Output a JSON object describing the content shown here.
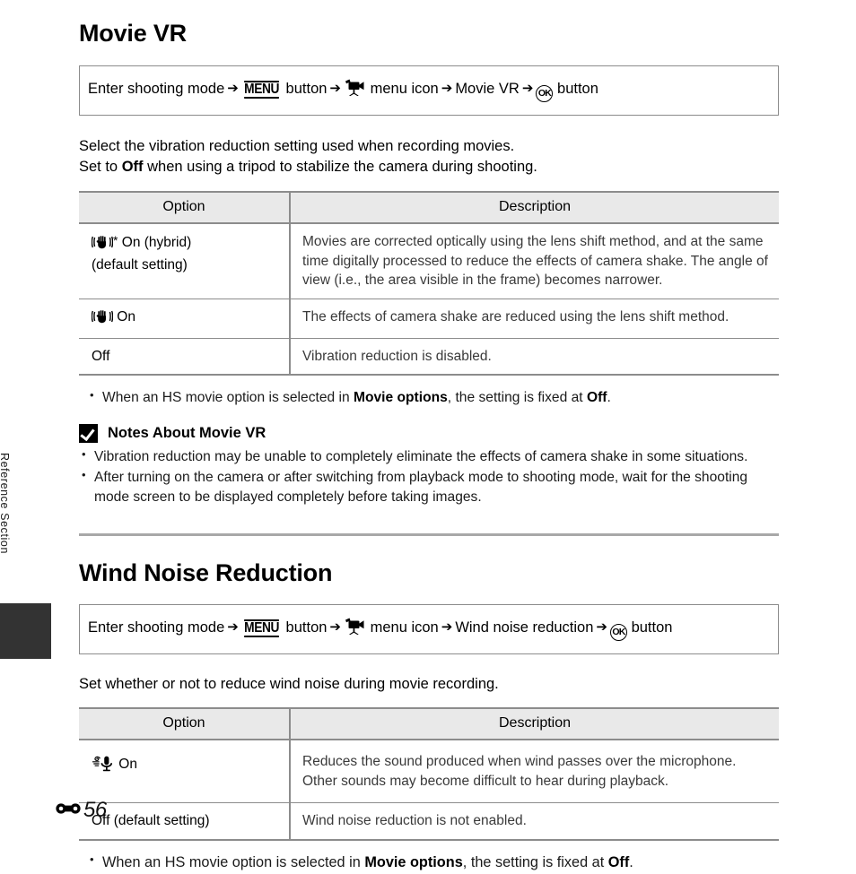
{
  "sidebar": {
    "vertical_label": "Reference Section"
  },
  "footer": {
    "marker_icon": "reference-section-bone-icon",
    "page_number": "56"
  },
  "movie_vr": {
    "title": "Movie VR",
    "nav_path": {
      "step1": "Enter shooting mode",
      "menu_icon_name": "menu-button-glyph",
      "menu_label": "MENU",
      "step2": "button",
      "movie_icon_name": "movie-camera-icon",
      "step3": "menu icon",
      "step4": "Movie VR",
      "ok_icon_name": "ok-button-glyph",
      "ok_label": "OK",
      "step5": "button"
    },
    "intro_line1": "Select the vibration reduction setting used when recording movies.",
    "intro_line2_pre": "Set to ",
    "intro_line2_bold": "Off",
    "intro_line2_post": " when using a tripod to stabilize the camera during shooting.",
    "table": {
      "headers": [
        "Option",
        "Description"
      ],
      "rows": [
        {
          "icon": "vr-hand-icon",
          "star": "*",
          "option_line1": " On (hybrid)",
          "option_line2": "(default setting)",
          "description": "Movies are corrected optically using the lens shift method, and at the same time digitally processed to reduce the effects of camera shake. The angle of view (i.e., the area visible in the frame) becomes narrower."
        },
        {
          "icon": "vr-hand-icon",
          "star": "",
          "option_line1": " On",
          "option_line2": "",
          "description": "The effects of camera shake are reduced using the lens shift method."
        },
        {
          "icon": "",
          "star": "",
          "option_line1": "Off",
          "option_line2": "",
          "description": "Vibration reduction is disabled."
        }
      ]
    },
    "bullet": {
      "pre": "When an HS movie option is selected in ",
      "bold1": "Movie options",
      "mid": ", the setting is fixed at ",
      "bold2": "Off",
      "post": "."
    },
    "notes": {
      "icon": "caution-check-icon",
      "heading": "Notes About Movie VR",
      "items": [
        "Vibration reduction may be unable to completely eliminate the effects of camera shake in some situations.",
        "After turning on the camera or after switching from playback mode to shooting mode, wait for the shooting mode screen to be displayed completely before taking images."
      ]
    }
  },
  "wind_noise": {
    "title": "Wind Noise Reduction",
    "nav_path": {
      "step1": "Enter shooting mode",
      "menu_icon_name": "menu-button-glyph",
      "menu_label": "MENU",
      "step2": "button",
      "movie_icon_name": "movie-camera-icon",
      "step3": "menu icon",
      "step4": "Wind noise reduction",
      "ok_icon_name": "ok-button-glyph",
      "ok_label": "OK",
      "step5": "button"
    },
    "intro_line1": "Set whether or not to reduce wind noise during movie recording.",
    "table": {
      "headers": [
        "Option",
        "Description"
      ],
      "rows": [
        {
          "icon": "wind-mic-icon",
          "option_line1": " On",
          "description": "Reduces the sound produced when wind passes over the microphone. Other sounds may become difficult to hear during playback."
        },
        {
          "icon": "",
          "option_line1": "Off (default setting)",
          "description": "Wind noise reduction is not enabled."
        }
      ]
    },
    "bullet": {
      "pre": "When an HS movie option is selected in ",
      "bold1": "Movie options",
      "mid": ", the setting is fixed at ",
      "bold2": "Off",
      "post": "."
    }
  },
  "colors": {
    "table_header_bg": "#e9e9e9",
    "rule": "#8c8c8c",
    "divider": "#a8a8a8",
    "tab_block": "#333333"
  }
}
